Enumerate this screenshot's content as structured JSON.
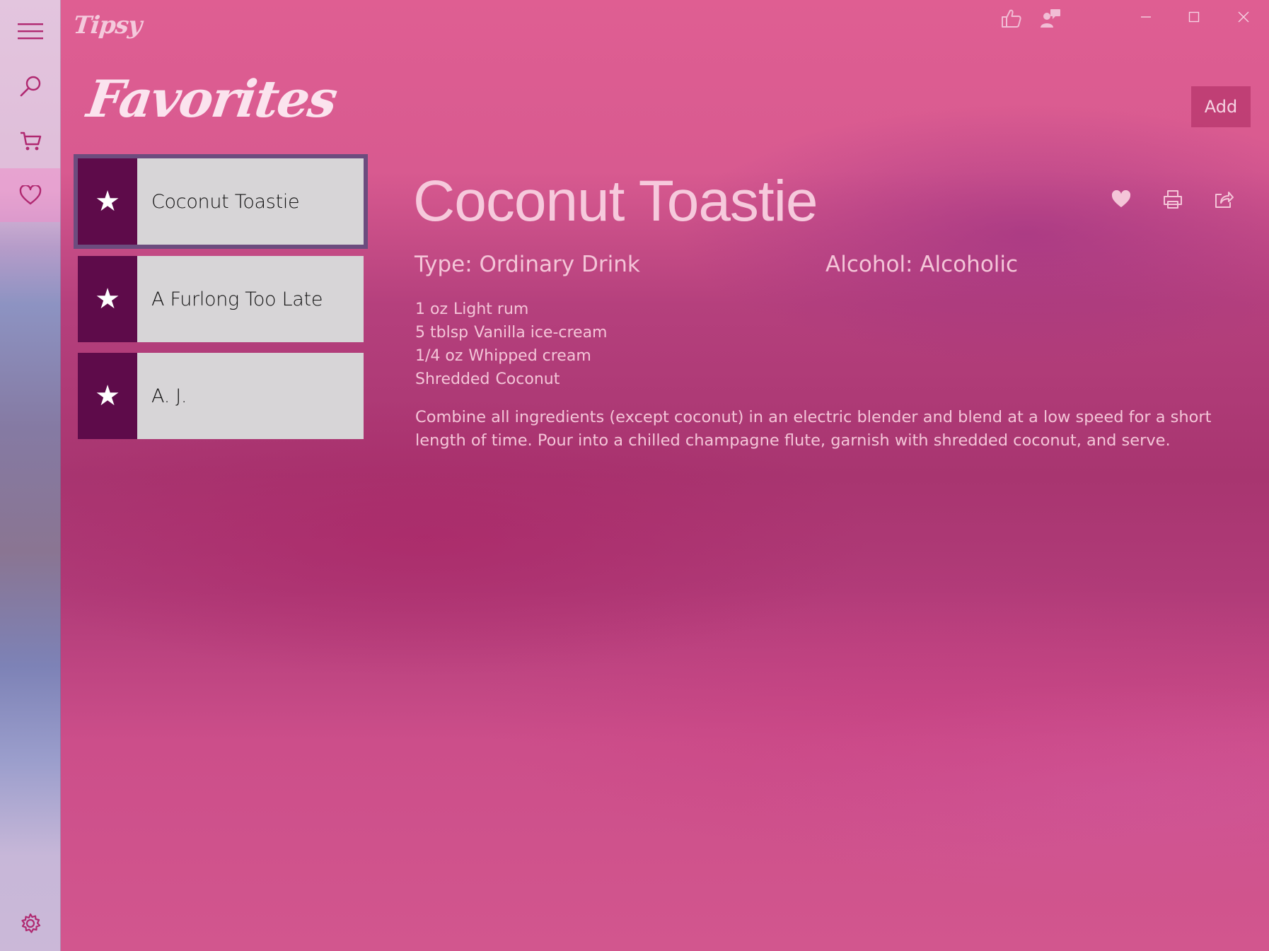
{
  "app": {
    "name": "Tipsy"
  },
  "nav": {
    "items": [
      {
        "id": "menu",
        "icon": "hamburger-icon",
        "active": false
      },
      {
        "id": "search",
        "icon": "search-icon",
        "active": false
      },
      {
        "id": "cart",
        "icon": "cart-icon",
        "active": false
      },
      {
        "id": "favorites",
        "icon": "heart-icon",
        "active": true
      }
    ],
    "settings_icon": "gear-icon"
  },
  "titlebar": {
    "icons": [
      "thumbs-up-icon",
      "feedback-person-icon"
    ],
    "window_controls": [
      "minimize-icon",
      "maximize-icon",
      "close-icon"
    ]
  },
  "page": {
    "title": "Favorites",
    "add_label": "Add"
  },
  "favorites": [
    {
      "name": "Coconut Toastie",
      "selected": true
    },
    {
      "name": "A Furlong Too Late",
      "selected": false
    },
    {
      "name": "A. J.",
      "selected": false
    }
  ],
  "detail": {
    "name": "Coconut Toastie",
    "type_label": "Type: Ordinary Drink",
    "alcohol_label": "Alcohol: Alcoholic",
    "actions": [
      "heart-filled-icon",
      "print-icon",
      "share-icon"
    ],
    "ingredients": [
      {
        "measure": "1 oz",
        "item": "Light rum"
      },
      {
        "measure": "5 tblsp",
        "item": "Vanilla ice-cream"
      },
      {
        "measure": "1/4 oz",
        "item": "Whipped cream"
      },
      {
        "measure": "Shredded",
        "item": "Coconut"
      }
    ],
    "instructions": "Combine all ingredients (except coconut) in an electric blender and blend at a low speed for a short length of time. Pour into a chilled champagne flute, garnish with shredded coconut, and serve."
  },
  "colors": {
    "accent": "#5e0b4a",
    "tile": "#d7d5d7",
    "text_light": "#f4c5d8",
    "selection": "#6c4c7e"
  }
}
